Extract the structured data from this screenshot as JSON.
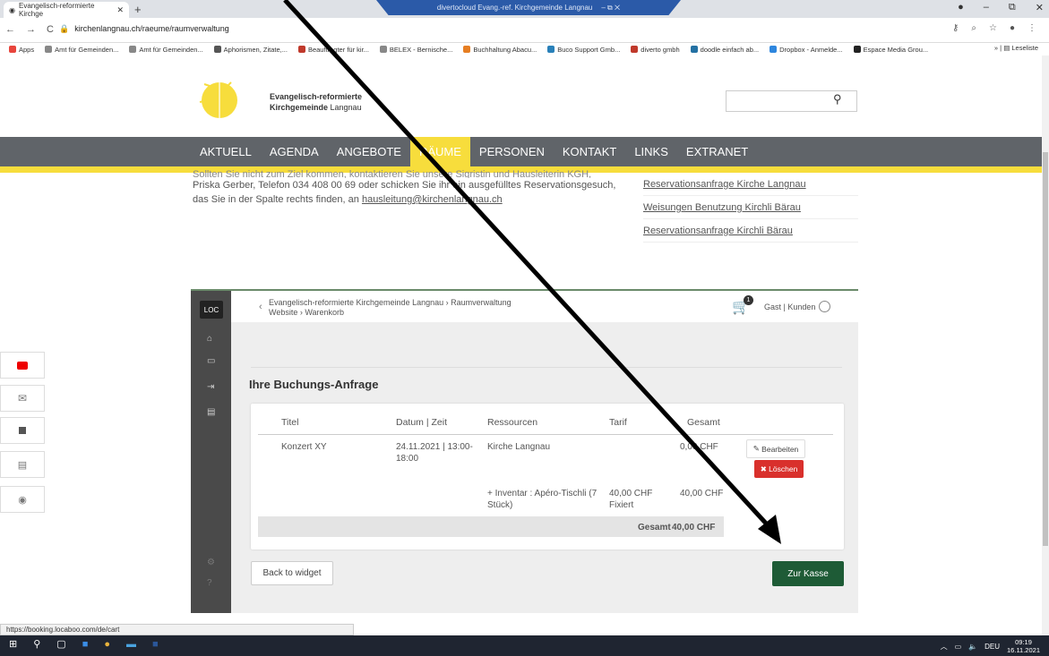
{
  "browser": {
    "tab_title": "Evangelisch-reformierte Kirchge",
    "remote_title": "divertocloud Evang.-ref. Kirchgemeinde Langnau",
    "url": "kirchenlangnau.ch/raeume/raumverwaltung",
    "bookmarks": [
      {
        "label": "Apps",
        "color": "#e8453c"
      },
      {
        "label": "Amt für Gemeinden...",
        "color": "#888"
      },
      {
        "label": "Amt für Gemeinden...",
        "color": "#888"
      },
      {
        "label": "Aphorismen, Zitate,...",
        "color": "#555"
      },
      {
        "label": "Beauftragter für kir...",
        "color": "#c0392b"
      },
      {
        "label": "BELEX - Bernische...",
        "color": "#888"
      },
      {
        "label": "Buchhaltung Abacu...",
        "color": "#e67e22"
      },
      {
        "label": "Buco Support Gmb...",
        "color": "#2980b9"
      },
      {
        "label": "diverto gmbh",
        "color": "#c0392b"
      },
      {
        "label": "doodle einfach ab...",
        "color": "#2471a3"
      },
      {
        "label": "Dropbox - Anmelde...",
        "color": "#2e86de"
      },
      {
        "label": "Espace Media Grou...",
        "color": "#222"
      }
    ],
    "reading_list": "Leseliste",
    "status_url": "https://booking.locaboo.com/de/cart"
  },
  "site": {
    "church_line1": "Evangelisch-reformierte",
    "church_line2_bold": "Kirchgemeinde",
    "church_line2_rest": " Langnau",
    "nav": [
      "AKTUELL",
      "AGENDA",
      "ANGEBOTE",
      "RÄUME",
      "PERSONEN",
      "KONTAKT",
      "LINKS",
      "EXTRANET"
    ],
    "nav_active_index": 3,
    "accent_yellow": "#f7dd3c",
    "nav_gray": "#606469",
    "cut_line": "Sollten Sie nicht zum Ziel kommen, kontaktieren Sie unsere Sigristin und Hausleiterin KGH,",
    "para_line1": "Priska Gerber, Telefon 034 408 00 69 oder schicken Sie ihr ein ausgefülltes Reservationsgesuch,",
    "para_line2_pre": "das Sie in der Spalte rechts finden, an ",
    "para_email": "hausleitung@kirchenlangnau.ch",
    "side_links": [
      "Reservationsanfrage Kirche Langnau",
      "Weisungen Benutzung Kirchli Bärau",
      "Reservationsanfrage Kirchli Bärau"
    ]
  },
  "widget": {
    "breadcrumb1": "Evangelisch-reformierte Kirchgemeinde Langnau  ›  Raumverwaltung",
    "breadcrumb2": "Website  ›  Warenkorb",
    "cart_count": "1",
    "user_label": "Gast  | Kunden",
    "heading": "Ihre Buchungs-Anfrage",
    "columns": [
      "Titel",
      "Datum | Zeit",
      "Ressourcen",
      "Tarif",
      "Gesamt"
    ],
    "row1": {
      "title": "Konzert XY",
      "datetime_l1": "24.11.2021 | 13:00-",
      "datetime_l2": "18:00",
      "resource": "Kirche Langnau",
      "total": "0,00 CHF"
    },
    "row2": {
      "resource_l1": "+ Inventar : Apéro-Tischli (7",
      "resource_l2": "Stück)",
      "tarif_l1": "40,00 CHF",
      "tarif_l2": "Fixiert",
      "total": "40,00 CHF"
    },
    "grand_total_label": "Gesamt",
    "grand_total_value": "40,00 CHF",
    "edit_label": "Bearbeiten",
    "delete_label": "Löschen",
    "back_label": "Back to widget",
    "checkout_label": "Zur Kasse",
    "checkout_color": "#1e5b36"
  },
  "taskbar": {
    "lang": "DEU",
    "time": "09:19",
    "date": "16.11.2021"
  }
}
